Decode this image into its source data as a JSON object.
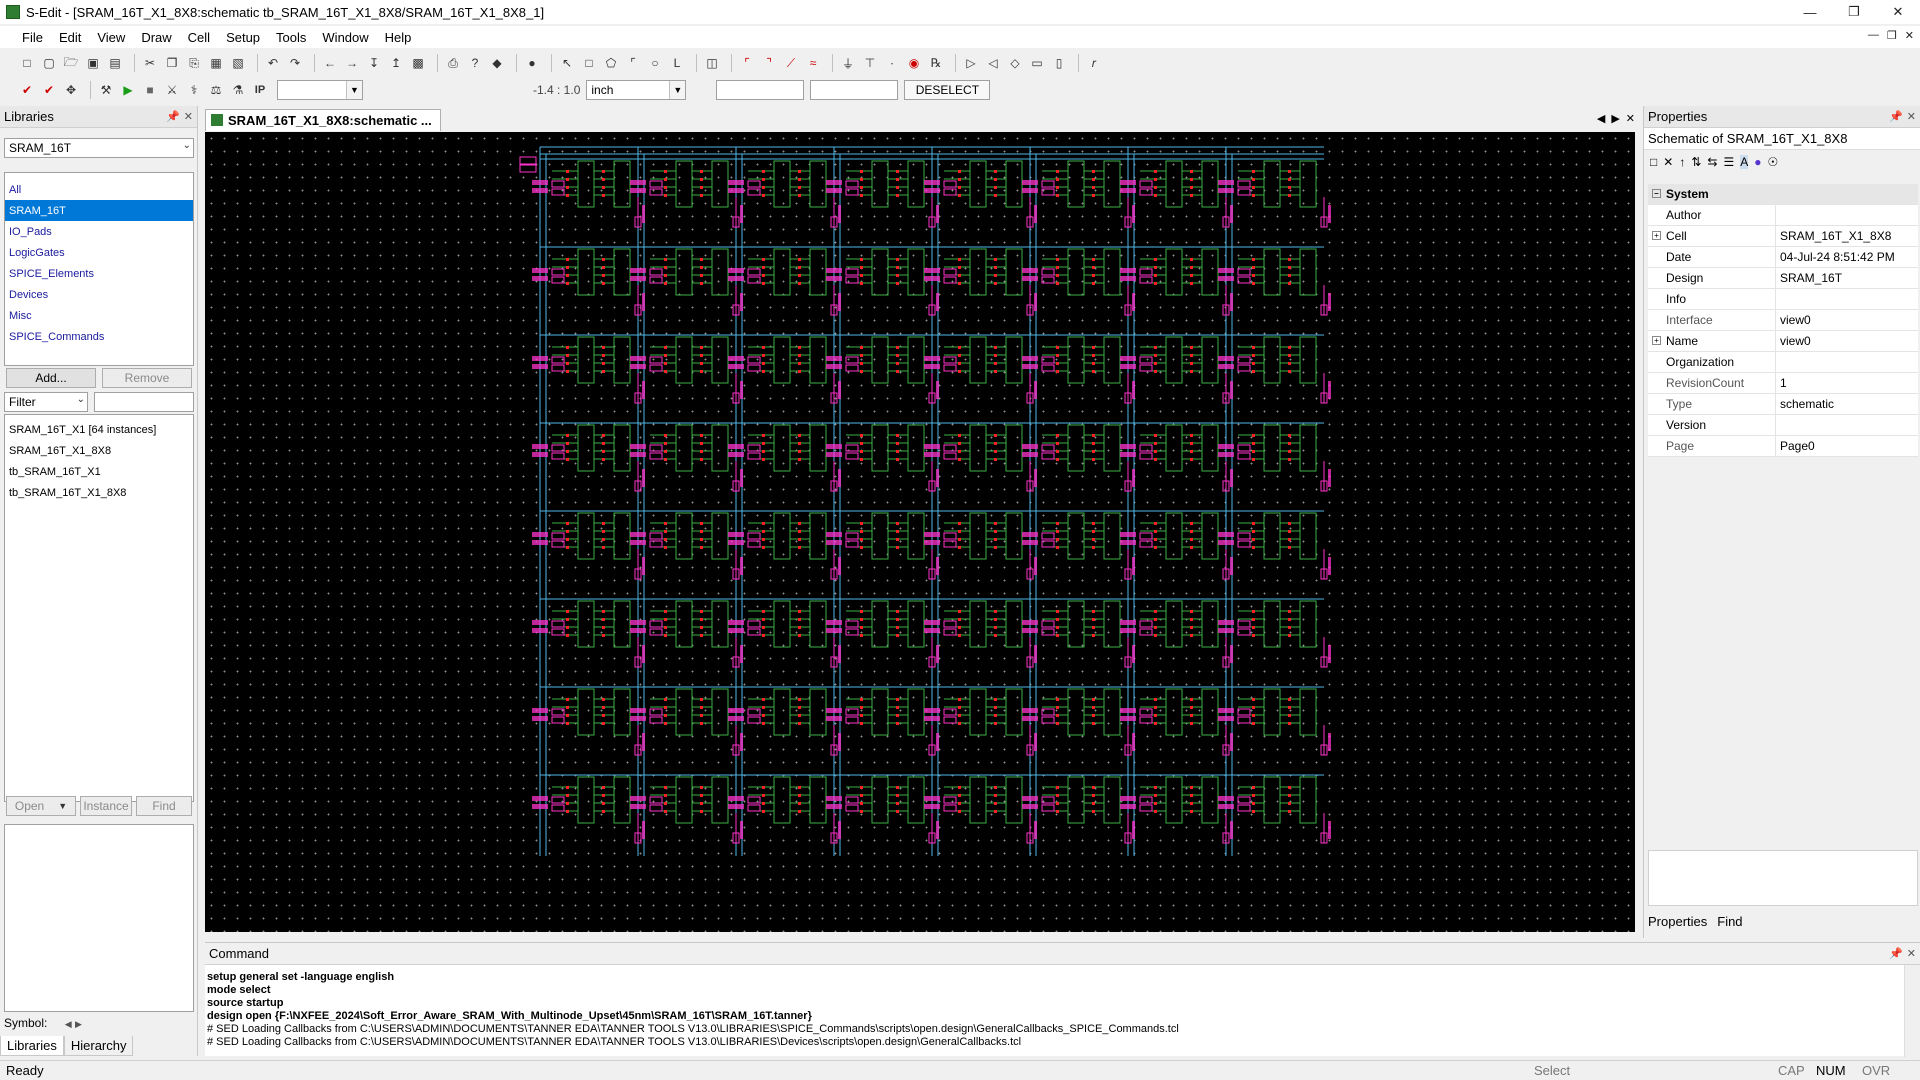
{
  "window": {
    "title": "S-Edit - [SRAM_16T_X1_8X8:schematic tb_SRAM_16T_X1_8X8/SRAM_16T_X1_8X8_1]"
  },
  "menu": [
    "File",
    "Edit",
    "View",
    "Draw",
    "Cell",
    "Setup",
    "Tools",
    "Window",
    "Help"
  ],
  "toolbar": {
    "coords": "-1.4 : 1.0",
    "unit": "inch",
    "deselect": "DESELECT"
  },
  "libraries": {
    "title": "Libraries",
    "selected_library": "SRAM_16T",
    "items": [
      "All",
      "SRAM_16T",
      "IO_Pads",
      "LogicGates",
      "SPICE_Elements",
      "Devices",
      "Misc",
      "SPICE_Commands"
    ],
    "selected_index": 1,
    "add_label": "Add...",
    "remove_label": "Remove",
    "filter_label": "Filter",
    "cells": [
      "SRAM_16T_X1 [64 instances]",
      "SRAM_16T_X1_8X8",
      "tb_SRAM_16T_X1",
      "tb_SRAM_16T_X1_8X8"
    ],
    "open_label": "Open",
    "instance_label": "Instance",
    "find_label": "Find",
    "symbol_label": "Symbol:",
    "tabs": [
      "Libraries",
      "Hierarchy"
    ]
  },
  "document": {
    "tab_label": "SRAM_16T_X1_8X8:schematic ..."
  },
  "properties": {
    "title": "Properties",
    "subtitle": "Schematic of SRAM_16T_X1_8X8",
    "category": "System",
    "rows": [
      {
        "key": "Author",
        "value": ""
      },
      {
        "key": "Cell",
        "value": "SRAM_16T_X1_8X8"
      },
      {
        "key": "Date",
        "value": "04-Jul-24 8:51:42 PM"
      },
      {
        "key": "Design",
        "value": "SRAM_16T"
      },
      {
        "key": "Info",
        "value": ""
      },
      {
        "key": "Interface",
        "value": "view0"
      },
      {
        "key": "Name",
        "value": "view0"
      },
      {
        "key": "Organization",
        "value": ""
      },
      {
        "key": "RevisionCount",
        "value": "1"
      },
      {
        "key": "Type",
        "value": "schematic"
      },
      {
        "key": "Version",
        "value": ""
      },
      {
        "key": "Page",
        "value": "Page0"
      }
    ],
    "tabs": [
      "Properties",
      "Find"
    ]
  },
  "command": {
    "title": "Command",
    "lines": [
      "setup general set -language english",
      "mode select",
      "source startup",
      "design open {F:\\NXFEE_2024\\Soft_Error_Aware_SRAM_With_Multinode_Upset\\45nm\\SRAM_16T\\SRAM_16T.tanner}",
      "# SED  Loading Callbacks from C:\\USERS\\ADMIN\\DOCUMENTS\\TANNER EDA\\TANNER TOOLS V13.0\\LIBRARIES\\SPICE_Commands\\scripts\\open.design\\GeneralCallbacks_SPICE_Commands.tcl",
      "# SED  Loading Callbacks from C:\\USERS\\ADMIN\\DOCUMENTS\\TANNER EDA\\TANNER TOOLS V13.0\\LIBRARIES\\Devices\\scripts\\open.design\\GeneralCallbacks.tcl"
    ]
  },
  "status": {
    "left": "Ready",
    "mode": "Select",
    "cap": "CAP",
    "num": "NUM",
    "ovr": "OVR"
  },
  "schematic": {
    "rows": 8,
    "cols": 8,
    "wire_color": "#4fb8e8",
    "cell_color": "#3cb043",
    "label_color": "#ff33cc",
    "pin_color": "#ff2020"
  }
}
